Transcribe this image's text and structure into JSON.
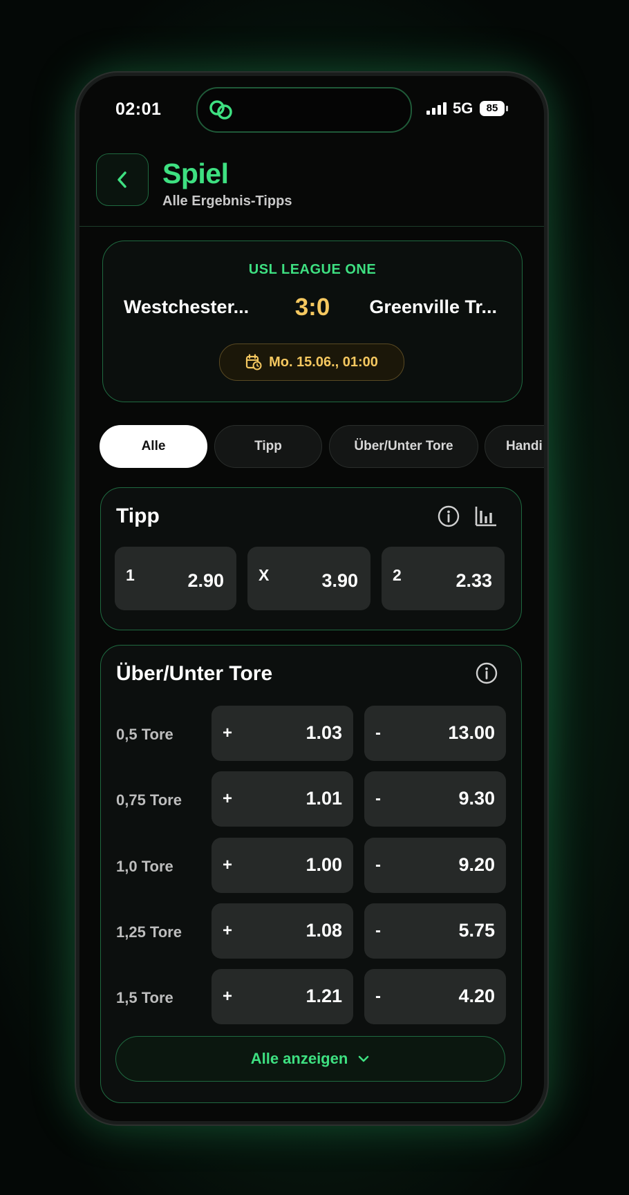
{
  "status_bar": {
    "time": "02:01",
    "network": "5G",
    "battery": "85"
  },
  "header": {
    "title": "Spiel",
    "subtitle": "Alle Ergebnis-Tipps"
  },
  "match": {
    "league": "USL LEAGUE ONE",
    "home_team": "Westchester...",
    "score": "3:0",
    "away_team": "Greenville Tr...",
    "date": "Mo. 15.06., 01:00"
  },
  "tabs": [
    {
      "label": "Alle",
      "active": true
    },
    {
      "label": "Tipp"
    },
    {
      "label": "Über/Unter Tore"
    },
    {
      "label": "Handi"
    }
  ],
  "tipp": {
    "title": "Tipp",
    "odds": [
      {
        "label": "1",
        "value": "2.90"
      },
      {
        "label": "X",
        "value": "3.90"
      },
      {
        "label": "2",
        "value": "2.33"
      }
    ]
  },
  "over_under": {
    "title": "Über/Unter Tore",
    "rows": [
      {
        "label": "0,5 Tore",
        "over_sign": "+",
        "over": "1.03",
        "under_sign": "-",
        "under": "13.00"
      },
      {
        "label": "0,75 Tore",
        "over_sign": "+",
        "over": "1.01",
        "under_sign": "-",
        "under": "9.30"
      },
      {
        "label": "1,0 Tore",
        "over_sign": "+",
        "over": "1.00",
        "under_sign": "-",
        "under": "9.20"
      },
      {
        "label": "1,25 Tore",
        "over_sign": "+",
        "over": "1.08",
        "under_sign": "-",
        "under": "5.75"
      },
      {
        "label": "1,5 Tore",
        "over_sign": "+",
        "over": "1.21",
        "under_sign": "-",
        "under": "4.20"
      }
    ],
    "show_all_label": "Alle anzeigen"
  },
  "colors": {
    "accent": "#3ee081",
    "score": "#f5c860",
    "background": "#070807"
  }
}
